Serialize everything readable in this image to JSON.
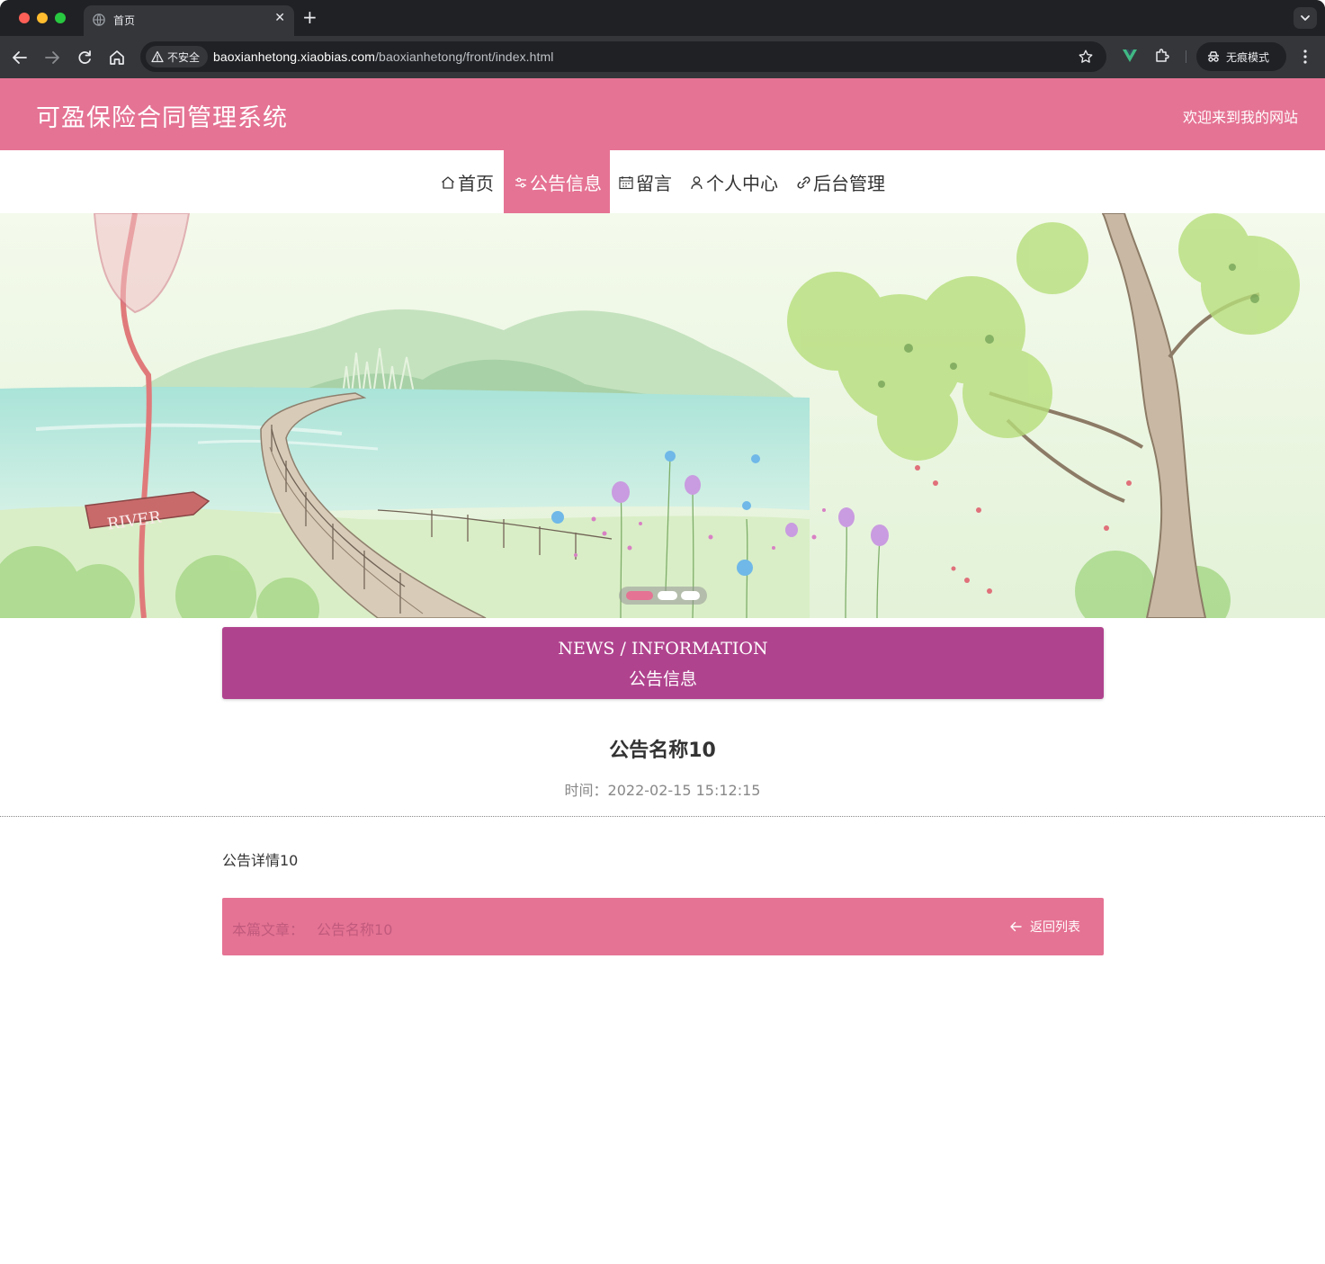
{
  "browser": {
    "tab_title": "首页",
    "new_tab_symbol": "+",
    "close_symbol": "✕",
    "security_label": "不安全",
    "url_host": "baoxianhetong.xiaobias.com",
    "url_path": "/baoxianhetong/front/index.html",
    "incognito_label": "无痕模式"
  },
  "header": {
    "title": "可盈保险合同管理系统",
    "welcome": "欢迎来到我的网站"
  },
  "nav": {
    "items": [
      {
        "label": "首页",
        "icon": "home-icon"
      },
      {
        "label": "公告信息",
        "icon": "sliders-icon",
        "active": true
      },
      {
        "label": "留言",
        "icon": "calendar-icon"
      },
      {
        "label": "个人中心",
        "icon": "user-icon"
      },
      {
        "label": "后台管理",
        "icon": "link-icon"
      }
    ]
  },
  "banner": {
    "sign_text": "RIVER",
    "slides": 3,
    "active_slide": 1
  },
  "section": {
    "title_en": "NEWS / INFORMATION",
    "title_cn": "公告信息"
  },
  "article": {
    "title": "公告名称10",
    "time_label": "时间：",
    "time_value": "2022-02-15 15:12:15",
    "body": "公告详情10"
  },
  "pager": {
    "current_label": "本篇文章：",
    "current_title": "公告名称10",
    "back_label": "返回列表"
  },
  "colors": {
    "accent": "#e57394",
    "section": "#b0438e",
    "chrome": "#202124"
  }
}
